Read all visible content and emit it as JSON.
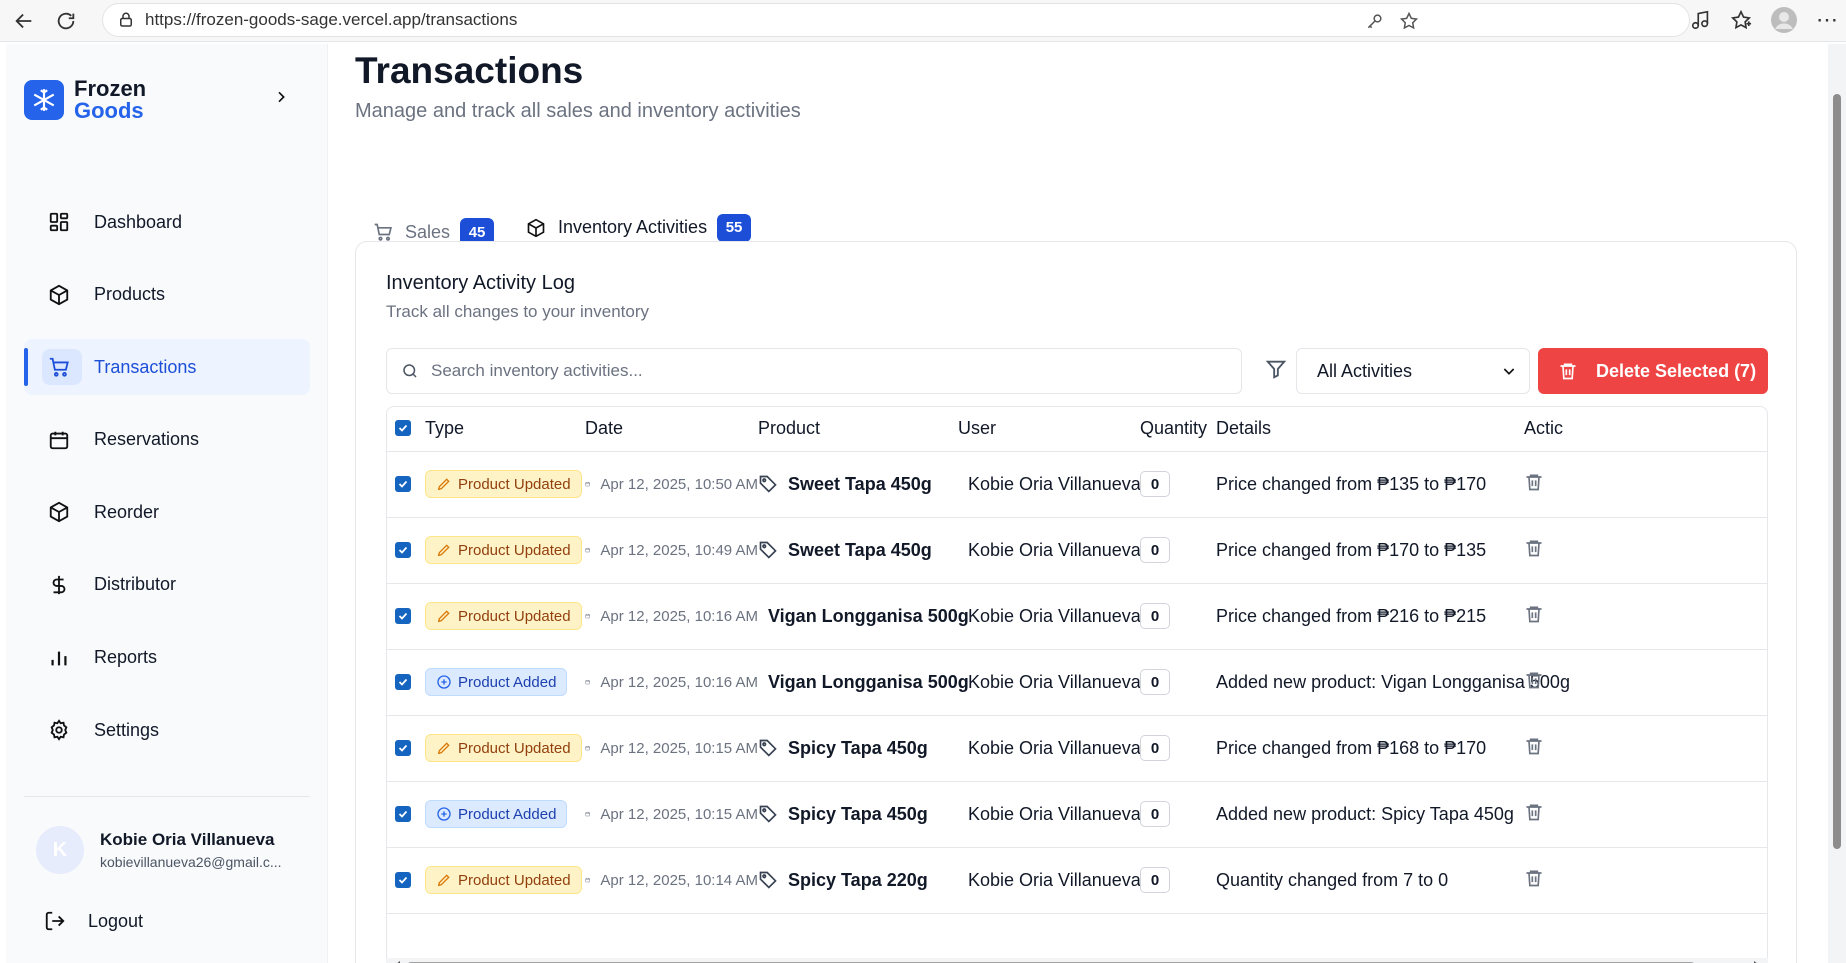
{
  "browser": {
    "url": "https://frozen-goods-sage.vercel.app/transactions"
  },
  "sidebar": {
    "brand_line1": "Frozen",
    "brand_line2": "Goods",
    "items": [
      {
        "label": "Dashboard",
        "icon": "dashboard-icon",
        "active": false
      },
      {
        "label": "Products",
        "icon": "box-icon",
        "active": false
      },
      {
        "label": "Transactions",
        "icon": "cart-icon",
        "active": true
      },
      {
        "label": "Reservations",
        "icon": "calendar-icon",
        "active": false
      },
      {
        "label": "Reorder",
        "icon": "box-icon",
        "active": false
      },
      {
        "label": "Distributor",
        "icon": "dollar-icon",
        "active": false
      },
      {
        "label": "Reports",
        "icon": "bar-chart-icon",
        "active": false
      },
      {
        "label": "Settings",
        "icon": "gear-icon",
        "active": false
      }
    ],
    "user": {
      "initial": "K",
      "name": "Kobie Oria Villanueva",
      "email": "kobievillanueva26@gmail.c..."
    },
    "logout_label": "Logout"
  },
  "page": {
    "title": "Transactions",
    "subtitle": "Manage and track all sales and inventory activities"
  },
  "tabs": [
    {
      "label": "Sales",
      "count": "45",
      "active": false
    },
    {
      "label": "Inventory Activities",
      "count": "55",
      "active": true
    }
  ],
  "log": {
    "title": "Inventory Activity Log",
    "subtitle": "Track all changes to your inventory",
    "search_placeholder": "Search inventory activities...",
    "filter_value": "All Activities",
    "delete_label": "Delete Selected (7)"
  },
  "table": {
    "headers": [
      "Type",
      "Date",
      "Product",
      "User",
      "Quantity",
      "Details",
      "Actic"
    ],
    "rows": [
      {
        "type": "Product Updated",
        "kind": "updated",
        "date": "Apr 12, 2025, 10:50 AM",
        "product": "Sweet Tapa 450g",
        "user": "Kobie Oria Villanueva",
        "quantity": "0",
        "details": "Price changed from ₱135 to ₱170"
      },
      {
        "type": "Product Updated",
        "kind": "updated",
        "date": "Apr 12, 2025, 10:49 AM",
        "product": "Sweet Tapa 450g",
        "user": "Kobie Oria Villanueva",
        "quantity": "0",
        "details": "Price changed from ₱170 to ₱135"
      },
      {
        "type": "Product Updated",
        "kind": "updated",
        "date": "Apr 12, 2025, 10:16 AM",
        "product": "Vigan Longganisa 500g",
        "user": "Kobie Oria Villanueva",
        "quantity": "0",
        "details": "Price changed from ₱216 to ₱215"
      },
      {
        "type": "Product Added",
        "kind": "added",
        "date": "Apr 12, 2025, 10:16 AM",
        "product": "Vigan Longganisa 500g",
        "user": "Kobie Oria Villanueva",
        "quantity": "0",
        "details": "Added new product: Vigan Longganisa 500g"
      },
      {
        "type": "Product Updated",
        "kind": "updated",
        "date": "Apr 12, 2025, 10:15 AM",
        "product": "Spicy Tapa 450g",
        "user": "Kobie Oria Villanueva",
        "quantity": "0",
        "details": "Price changed from ₱168 to ₱170"
      },
      {
        "type": "Product Added",
        "kind": "added",
        "date": "Apr 12, 2025, 10:15 AM",
        "product": "Spicy Tapa 450g",
        "user": "Kobie Oria Villanueva",
        "quantity": "0",
        "details": "Added new product: Spicy Tapa 450g"
      },
      {
        "type": "Product Updated",
        "kind": "updated",
        "date": "Apr 12, 2025, 10:14 AM",
        "product": "Spicy Tapa 220g",
        "user": "Kobie Oria Villanueva",
        "quantity": "0",
        "details": "Quantity changed from 7 to 0"
      }
    ]
  },
  "colors": {
    "accent": "#2563eb",
    "danger": "#ef4444",
    "updated_badge": "#fef3c7",
    "added_badge": "#dbeafe"
  }
}
